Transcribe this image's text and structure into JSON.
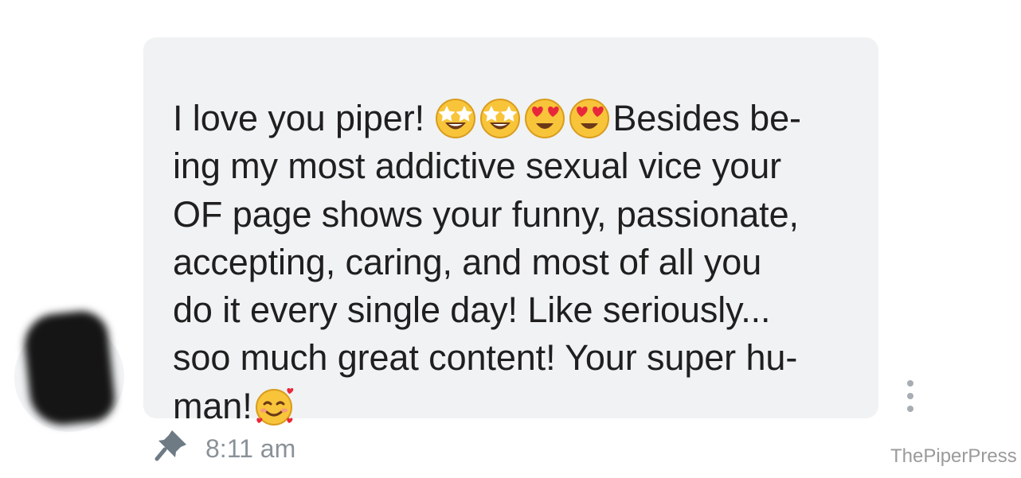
{
  "message": {
    "lines": [
      "I love you piper!",
      "Besides be-",
      "ing my most addictive sexual vice your",
      "OF page shows your funny, passionate,",
      "accepting, caring, and most of all you",
      "do it every single day! Like seriously...",
      "soo much great content! Your super hu-",
      "man!"
    ],
    "time": "8:11 am",
    "emojis": [
      "star-struck-icon",
      "star-struck-icon",
      "heart-eyes-icon",
      "heart-eyes-icon",
      "smiling-face-with-hearts-icon"
    ]
  },
  "watermark": "ThePiperPress",
  "colors": {
    "bubble": "#f0f2f4",
    "text": "#1f1f1f",
    "meta": "#8a9298"
  }
}
